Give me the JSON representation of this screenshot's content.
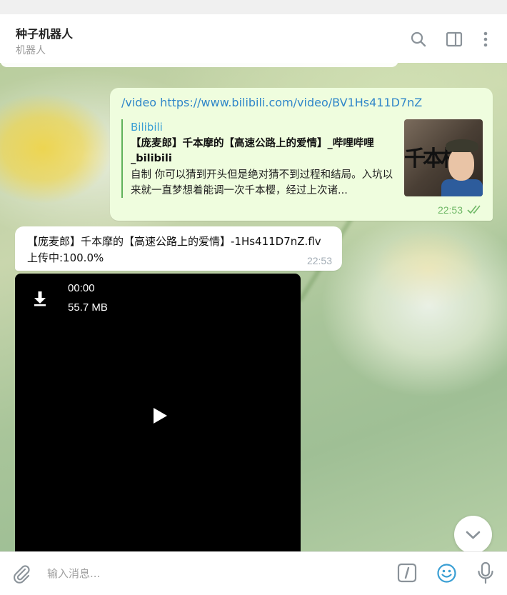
{
  "header": {
    "title": "种子机器人",
    "subtitle": "机器人",
    "icons": [
      "search-icon",
      "sidebar-icon",
      "more-vertical-icon"
    ]
  },
  "messages": {
    "outgoing": {
      "text": "/video https://www.bilibili.com/video/BV1Hs411D7nZ",
      "preview": {
        "site": "Bilibili",
        "title": "【庞麦郎】千本摩的【高速公路上的爱情】_哔哩哔哩_bilibili",
        "description": "自制 你可以猜到开头但是绝对猜不到过程和结局。入坑以来就一直梦想着能调一次千本樱，经过上次诸...",
        "thumbnail_text": "千本桜"
      },
      "time": "22:53",
      "status": "read"
    },
    "incoming": {
      "line1": "【庞麦郎】千本摩的【高速公路上的爱情】-1Hs411D7nZ.flv",
      "line2": "上传中:100.0%",
      "time": "22:53"
    },
    "video": {
      "duration": "00:00",
      "size": "55.7 MB"
    }
  },
  "composer": {
    "placeholder": "输入消息..."
  },
  "colors": {
    "link": "#2f86c9",
    "outgoing_bubble": "#effdde",
    "read_tick": "#6fb866",
    "accent": "#3a9fd4"
  }
}
